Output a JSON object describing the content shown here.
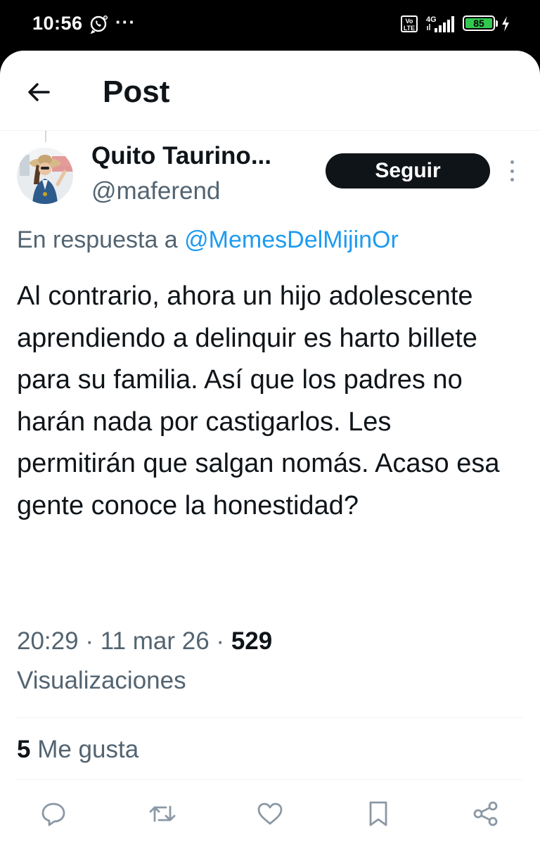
{
  "status_bar": {
    "time": "10:56",
    "more": "···",
    "volte": "Vo LTE",
    "network": "4G",
    "battery": "85",
    "icons": [
      "whatsapp-icon",
      "volte-icon",
      "signal-icon",
      "battery-icon",
      "charging-icon"
    ]
  },
  "header": {
    "title": "Post",
    "back_icon": "arrow-left-icon"
  },
  "post": {
    "author_name": "Quito Taurino...",
    "author_handle": "@maferend",
    "follow_label": "Seguir",
    "reply_prefix": "En respuesta a",
    "reply_handle": "@MemesDelMijinOr",
    "text": "Al contrario, ahora un hijo adolescente aprendiendo a delinquir es harto billete para su familia. Así que los padres no harán nada por castigarlos. Les permitirán que salgan nomás. Acaso esa gente conoce la honestidad?",
    "time": "20:29",
    "date": "11 mar 26",
    "separator": " · ",
    "views_count": "529",
    "views_label": "Visualizaciones",
    "likes_count": "5",
    "likes_label": "Me gusta"
  },
  "actions": [
    "reply-icon",
    "repost-icon",
    "like-icon",
    "bookmark-icon",
    "share-icon"
  ],
  "colors": {
    "text_primary": "#0f1419",
    "text_secondary": "#536471",
    "link": "#1d9bf0",
    "divider": "#eff3f4",
    "follow_bg": "#0f1419",
    "battery_fill": "#32c850"
  }
}
